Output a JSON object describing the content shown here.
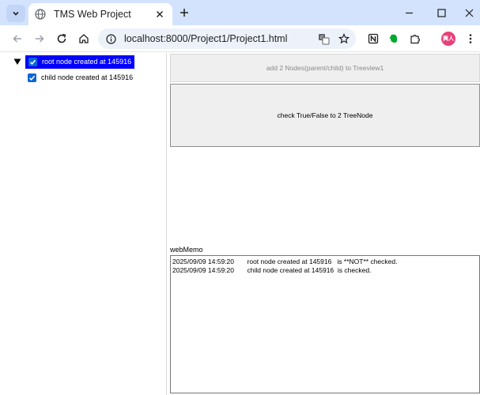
{
  "browser": {
    "tab_title": "TMS Web Project",
    "url": "localhost:8000/Project1/Project1.html",
    "profile_initials": "興人"
  },
  "treeview": {
    "nodes": [
      {
        "label": "root node created at 145916",
        "checked": true,
        "selected": true,
        "expanded": true
      },
      {
        "label": "child node created at 145916",
        "checked": true,
        "selected": false
      }
    ]
  },
  "buttons": {
    "add_nodes": "add 2 Nodes(parent/child) to Treeview1",
    "check_nodes": "check True/False to 2 TreeNode"
  },
  "memo": {
    "label": "webMemo",
    "lines": [
      "2025/09/09 14:59:20       root node created at 145916   is **NOT** checked.",
      "2025/09/09 14:59:20       child node created at 145916  is checked."
    ]
  },
  "colors": {
    "selected_node_bg": "#0000ff",
    "checkbox": "#0a66d6",
    "tabstrip": "#d3e3fd"
  }
}
